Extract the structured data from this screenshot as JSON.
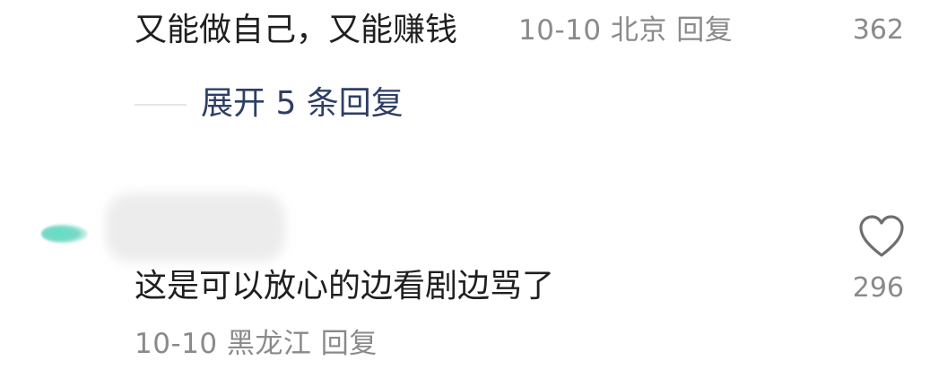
{
  "comments": [
    {
      "text": "又能做自己，又能赚钱",
      "meta": "10-10 北京 回复",
      "likes": "362",
      "expand_replies": "展开 5 条回复"
    },
    {
      "text": "这是可以放心的边看剧边骂了",
      "meta": "10-10 黑龙江 回复",
      "likes": "296",
      "like_icon": "heart-icon"
    }
  ]
}
